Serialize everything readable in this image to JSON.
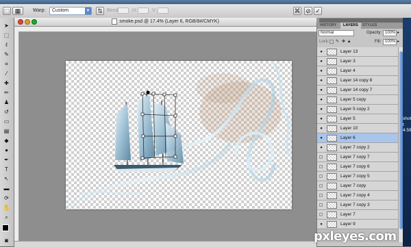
{
  "options_bar": {
    "warp_label": "Warp:",
    "warp_value": "Custom",
    "bend_label": "Bend:",
    "h_label": "H:",
    "v_label": "V:",
    "h_value": "0.0",
    "v_value": "0.0",
    "bend_value": "0.0"
  },
  "document": {
    "title": "smoke.psd @ 17.4% (Layer 6, RGB/8#/CMYK)"
  },
  "panel": {
    "tabs": [
      "HISTORY",
      "LAYERS",
      "STYLES"
    ],
    "active_tab": "LAYERS",
    "blend_mode": "Normal",
    "opacity_label": "Opacity:",
    "opacity_value": "100%",
    "lock_label": "Lock:",
    "fill_label": "Fill:",
    "fill_value": "100%",
    "layers": [
      {
        "name": "Layer 13",
        "visible": true,
        "selected": false
      },
      {
        "name": "Layer 3",
        "visible": true,
        "selected": false
      },
      {
        "name": "Layer 4",
        "visible": true,
        "selected": false
      },
      {
        "name": "Layer 14 copy 8",
        "visible": true,
        "selected": false
      },
      {
        "name": "Layer 14 copy 7",
        "visible": true,
        "selected": false
      },
      {
        "name": "Layer 5 copy",
        "visible": true,
        "selected": false
      },
      {
        "name": "Layer 5 copy 2",
        "visible": true,
        "selected": false
      },
      {
        "name": "Layer 5",
        "visible": true,
        "selected": false
      },
      {
        "name": "Layer 10",
        "visible": true,
        "selected": false
      },
      {
        "name": "Layer 6",
        "visible": true,
        "selected": true
      },
      {
        "name": "Layer 7 copy 2",
        "visible": true,
        "selected": false
      },
      {
        "name": "Layer 7 copy 7",
        "visible": false,
        "selected": false
      },
      {
        "name": "Layer 7 copy 6",
        "visible": false,
        "selected": false
      },
      {
        "name": "Layer 7 copy 5",
        "visible": false,
        "selected": false
      },
      {
        "name": "Layer 7 copy",
        "visible": false,
        "selected": false
      },
      {
        "name": "Layer 7 copy 4",
        "visible": false,
        "selected": false
      },
      {
        "name": "Layer 7 copy 3",
        "visible": false,
        "selected": false
      },
      {
        "name": "Layer 7",
        "visible": false,
        "selected": false
      },
      {
        "name": "Layer 9",
        "visible": true,
        "selected": false
      }
    ]
  },
  "far_right": {
    "line1": "shot",
    "line2": "t 4.59"
  },
  "watermark": "pxleyes.com",
  "colors": {
    "accent": "#5c87c9",
    "selected_layer": "#a8c5ec",
    "panel_bg": "#c6c6c6",
    "workspace": "#8e8e8e"
  }
}
